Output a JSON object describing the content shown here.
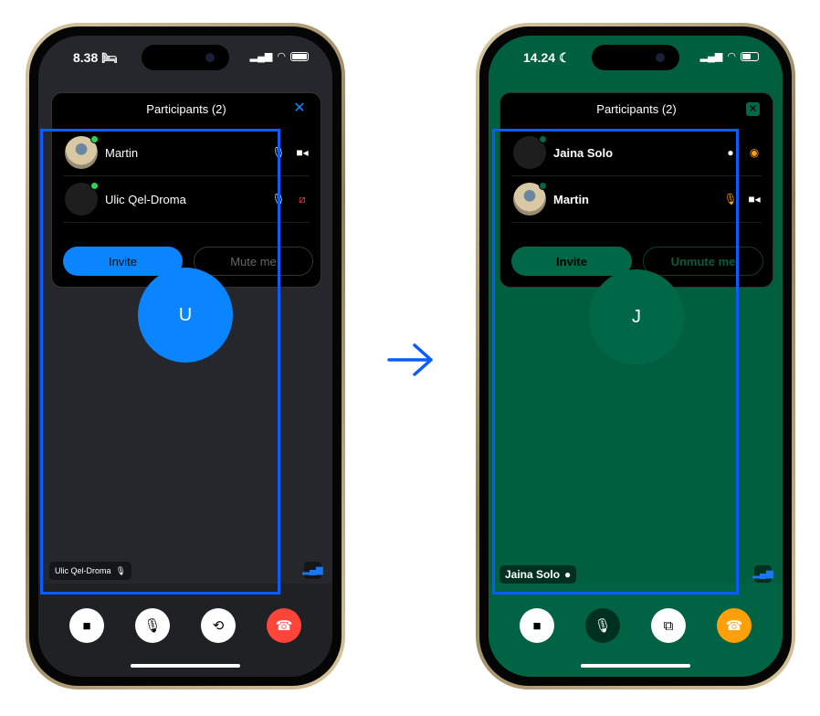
{
  "before": {
    "status": {
      "time": "8.38",
      "mode_icon": "bed-icon"
    },
    "panel": {
      "title": "Participants (2)",
      "close_icon": "close-x-icon",
      "participants": [
        {
          "name": "Martin",
          "mic": "mic-icon",
          "camera": "video-on-icon"
        },
        {
          "name": "Ulic Qel-Droma",
          "mic": "mic-icon",
          "camera": "video-off-icon"
        }
      ],
      "invite": "Invite",
      "mute": "Mute me"
    },
    "avatar_initial": "U",
    "speaker_tag": "Ulic Qel-Droma",
    "colors": {
      "background": "#25272c",
      "accent": "#0a84ff",
      "hangup": "#ff453a"
    }
  },
  "after": {
    "status": {
      "time": "14.24",
      "mode_icon": "moon-icon"
    },
    "panel": {
      "title": "Participants (2)",
      "close_icon": "close-x-icon",
      "participants": [
        {
          "name": "Jaina Solo",
          "mic": "pin-icon",
          "camera": "video-off-icon"
        },
        {
          "name": "Martin",
          "mic": "mic-icon",
          "camera": "video-on-icon"
        }
      ],
      "invite": "Invite",
      "mute": "Unmute me"
    },
    "avatar_initial": "J",
    "speaker_tag": "Jaina Solo",
    "colors": {
      "background": "#005f3f",
      "accent": "#006847",
      "hangup": "#ff9f0a"
    }
  },
  "arrow_icon": "arrow-right-icon"
}
